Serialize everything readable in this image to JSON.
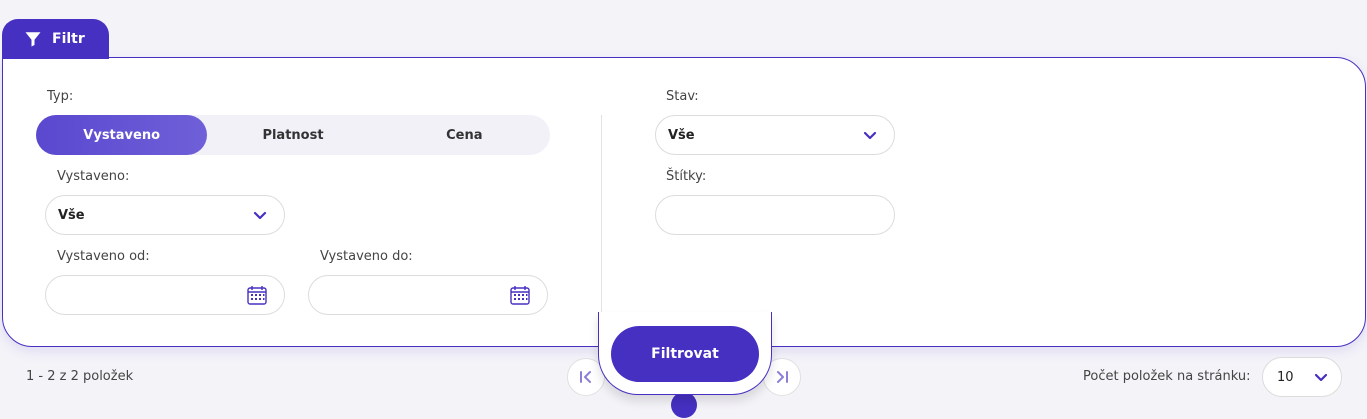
{
  "filter_tab": {
    "label": "Filtr",
    "icon": "funnel-icon"
  },
  "type_filter": {
    "label": "Typ:",
    "options": [
      "Vystaveno",
      "Platnost",
      "Cena"
    ],
    "selected": "Vystaveno"
  },
  "issued": {
    "label": "Vystaveno:",
    "value": "Vše",
    "from_label": "Vystaveno od:",
    "from_value": "",
    "to_label": "Vystaveno do:",
    "to_value": ""
  },
  "status": {
    "label": "Stav:",
    "value": "Vše"
  },
  "tags": {
    "label": "Štítky:",
    "value": ""
  },
  "filter_button": {
    "label": "Filtrovat"
  },
  "pagination": {
    "summary": "1 - 2 z 2 položek",
    "per_page_label": "Počet položek na stránku:",
    "per_page_value": "10"
  },
  "colors": {
    "accent": "#4630c2",
    "background": "#f4f3f8"
  }
}
